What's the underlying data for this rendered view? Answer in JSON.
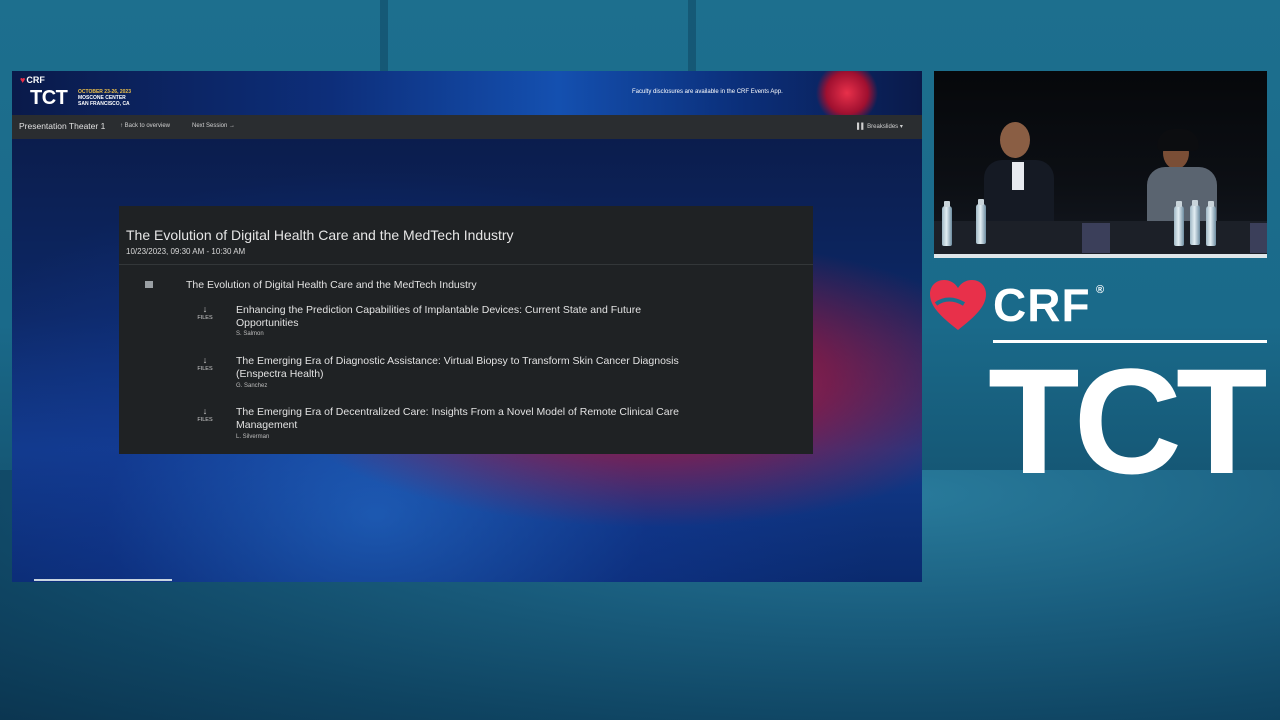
{
  "banner": {
    "logo_crf": "CRF",
    "logo_tct": "TCT",
    "logo_dates": "OCTOBER 23-26, 2023",
    "logo_venue_1": "MOSCONE CENTER",
    "logo_venue_2": "SAN FRANCISCO, CA",
    "notice": "Faculty disclosures are available in the CRF Events App."
  },
  "nav": {
    "title": "Presentation Theater 1",
    "back_label": "↑ Back to overview",
    "next_label": "Next Session →",
    "breakslides_label": "▌▌ Breakslides ▾"
  },
  "session": {
    "title": "The Evolution of Digital Health Care and the MedTech Industry",
    "time": "10/23/2023, 09:30 AM - 10:30 AM",
    "group_title": "The Evolution of Digital Health Care and the MedTech Industry",
    "files_label": "FILES",
    "files_arrow": "↓",
    "talks": [
      {
        "title": "Enhancing the Prediction Capabilities of Implantable Devices: Current State and Future Opportunities",
        "author": "S. Salmon"
      },
      {
        "title": "The Emerging Era of Diagnostic Assistance: Virtual Biopsy to Transform Skin Cancer Diagnosis (Enspectra Health)",
        "author": "G. Sanchez"
      },
      {
        "title": "The Emerging Era of Decentralized Care: Insights From a Novel Model of Remote Clinical Care Management",
        "author": "L. Silverman"
      }
    ]
  },
  "brand": {
    "crf": "CRF",
    "registered": "®",
    "tct": "TCT",
    "accent_color": "#e8304a"
  },
  "icons": {
    "heart": "heart-logo-icon",
    "group": "list-square-icon",
    "download": "download-arrow-icon"
  }
}
